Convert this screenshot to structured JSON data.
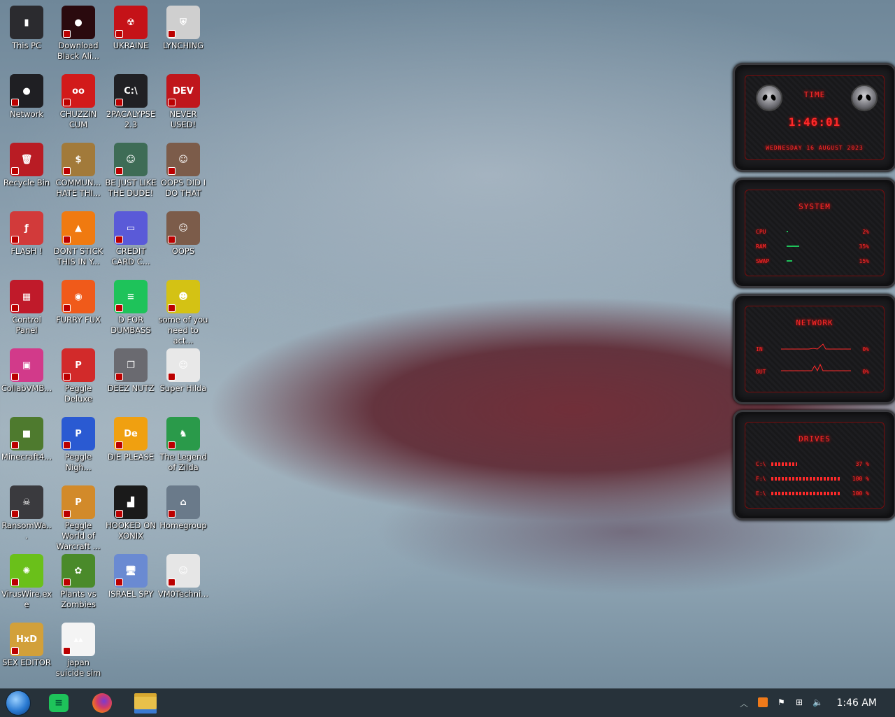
{
  "desktop_icons": [
    {
      "label": "This PC",
      "color": "#2b2b2f",
      "glyph": "▮"
    },
    {
      "label": "Download Black Ali...",
      "color": "#2a0a0e",
      "glyph": "●"
    },
    {
      "label": "UKRAINE",
      "color": "#c51218",
      "glyph": "☢"
    },
    {
      "label": "LYNCHING",
      "color": "#cfcfcf",
      "glyph": "⛨"
    },
    {
      "label": "Network",
      "color": "#1f1f23",
      "glyph": "●"
    },
    {
      "label": "CHUZZIN CUM",
      "color": "#d21a1a",
      "glyph": "oo"
    },
    {
      "label": "2PACALYPSE 2.3",
      "color": "#202024",
      "glyph": "C:\\"
    },
    {
      "label": "NEVER USED!",
      "color": "#c0161c",
      "glyph": "DEV"
    },
    {
      "label": "Recycle Bin",
      "color": "#b91c24",
      "glyph": "🗑"
    },
    {
      "label": "COMMUN... HATE THI...",
      "color": "#a27a3a",
      "glyph": "$"
    },
    {
      "label": "BE JUST LIKE THE DUDE!",
      "color": "#3e6c56",
      "glyph": "☺"
    },
    {
      "label": "OOPS DID I DO THAT",
      "color": "#7c5c4a",
      "glyph": "☺"
    },
    {
      "label": "FLASH !",
      "color": "#d23a3a",
      "glyph": "ƒ"
    },
    {
      "label": "DONT STICK THIS IN Y...",
      "color": "#f07a10",
      "glyph": "▲"
    },
    {
      "label": "CREDIT CARD C...",
      "color": "#5a5ad8",
      "glyph": "▭"
    },
    {
      "label": "OOPS",
      "color": "#7c5c4a",
      "glyph": "☺"
    },
    {
      "label": "Control Panel",
      "color": "#c01a2a",
      "glyph": "▦"
    },
    {
      "label": "FURRY FUX",
      "color": "#f05a1a",
      "glyph": "◉"
    },
    {
      "label": "D FOR DUMBASS",
      "color": "#1ec35a",
      "glyph": "≡"
    },
    {
      "label": "some of you need to act...",
      "color": "#d4c214",
      "glyph": "☻"
    },
    {
      "label": "CollabVMB...",
      "color": "#d23a8a",
      "glyph": "▣"
    },
    {
      "label": "Peggle Deluxe",
      "color": "#d22a2a",
      "glyph": "P"
    },
    {
      "label": "DEEZ NUTZ",
      "color": "#6a6a70",
      "glyph": "❐"
    },
    {
      "label": "Super Hilda",
      "color": "#e8e8e8",
      "glyph": "☺"
    },
    {
      "label": "Minecraft4...",
      "color": "#4e7a2e",
      "glyph": "■"
    },
    {
      "label": "Peggle Nigh...",
      "color": "#2a5ad2",
      "glyph": "P"
    },
    {
      "label": "DIE PLEASE",
      "color": "#f0a010",
      "glyph": "De"
    },
    {
      "label": "The Legend of Zilda",
      "color": "#2a9a4a",
      "glyph": "♞"
    },
    {
      "label": "RansomWa...",
      "color": "#3a3a3e",
      "glyph": "☠"
    },
    {
      "label": "Peggle World of Warcraft ...",
      "color": "#d28a2a",
      "glyph": "P"
    },
    {
      "label": "HOOKED ON XONIX",
      "color": "#1a1a1a",
      "glyph": "▟"
    },
    {
      "label": "Homegroup",
      "color": "#6a7a8a",
      "glyph": "⌂"
    },
    {
      "label": "VirusWire.exe",
      "color": "#6ac01a",
      "glyph": "✺"
    },
    {
      "label": "Plants vs Zombies",
      "color": "#4a8a2a",
      "glyph": "✿"
    },
    {
      "label": "ISRAEL SPY",
      "color": "#6a8ad2",
      "glyph": "🖥"
    },
    {
      "label": "VM0Techni...",
      "color": "#e6e6e6",
      "glyph": "☺"
    },
    {
      "label": "SEX EDITOR",
      "color": "#d2a03a",
      "glyph": "HxD"
    },
    {
      "label": "japan suicide sim",
      "color": "#f4f4f4",
      "glyph": "▴▴"
    }
  ],
  "widget": {
    "time_title": "TIME",
    "time": "1:46:01",
    "date": "WEDNESDAY 16 AUGUST 2023",
    "system_title": "SYSTEM",
    "system_rows": [
      {
        "label": "CPU",
        "value": "2%",
        "fraction": 0.02
      },
      {
        "label": "RAM",
        "value": "35%",
        "fraction": 0.35
      },
      {
        "label": "SWAP",
        "value": "15%",
        "fraction": 0.15
      }
    ],
    "network_title": "NETWORK",
    "network_rows": [
      {
        "label": "IN",
        "value": "0%"
      },
      {
        "label": "OUT",
        "value": "0%"
      }
    ],
    "drives_title": "DRIVES",
    "drive_rows": [
      {
        "label": "C:\\",
        "value": "37 %",
        "fraction": 0.37
      },
      {
        "label": "F:\\",
        "value": "100 %",
        "fraction": 1.0
      },
      {
        "label": "E:\\",
        "value": "100 %",
        "fraction": 1.0
      }
    ]
  },
  "taskbar": {
    "apps": [
      {
        "name": "start-orb",
        "color": "#3a9ae8"
      },
      {
        "name": "d-for-dumbass",
        "color": "#1ec35a"
      },
      {
        "name": "firefox",
        "color": "#f05a1a"
      },
      {
        "name": "file-explorer",
        "color": "#e8c04a"
      }
    ],
    "clock": "1:46 AM"
  },
  "colors": {
    "accent": "#ff2a2a",
    "taskbar": "#27323a"
  }
}
